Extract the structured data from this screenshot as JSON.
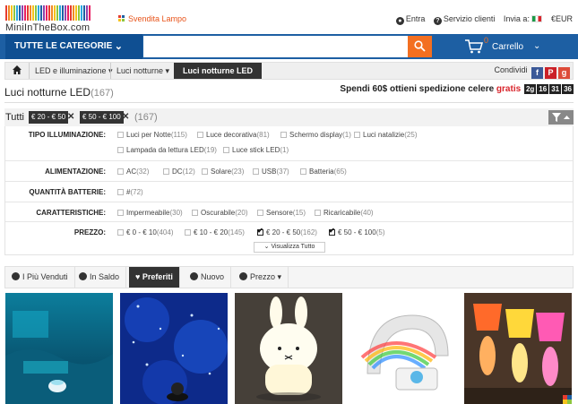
{
  "header": {
    "logo_text": "MiniInTheBox.com",
    "flash_sale": "Svendita Lampo",
    "links": {
      "login": "Entra",
      "support": "Servizio clienti",
      "ship_to": "Invia a:",
      "currency": "€EUR"
    }
  },
  "search": {
    "all_categories": "TUTTE LE CATEGORIE",
    "query": "",
    "placeholder": "",
    "cart_label": "Carrello",
    "cart_count": "0"
  },
  "breadcrumb": {
    "items": [
      "LED e illuminazione",
      "Luci notturne",
      "Luci notturne LED"
    ],
    "share_label": "Condividi"
  },
  "page": {
    "title": "Luci notturne LED",
    "count": "(167)",
    "promo_text": "Spendi 60$ ottieni spedizione celere",
    "promo_free": "gratis",
    "timer": [
      "2g",
      "16",
      "31",
      "36"
    ]
  },
  "active_filters": {
    "label": "Tutti",
    "chips": [
      "€ 20 - € 50",
      "€ 50 - € 100"
    ],
    "count": "(167)"
  },
  "filters": [
    {
      "label": "TIPO ILLUMINAZIONE:",
      "options": [
        {
          "name": "Luci per Notte",
          "count": "(115)",
          "checked": false
        },
        {
          "name": "Luce decorativa",
          "count": "(81)",
          "checked": false
        },
        {
          "name": "Schermo display",
          "count": "(1)",
          "checked": false
        },
        {
          "name": "Luci natalizie",
          "count": "(25)",
          "checked": false
        },
        {
          "name": "Lampada da lettura LED",
          "count": "(19)",
          "checked": false
        },
        {
          "name": "Luce stick LED",
          "count": "(1)",
          "checked": false
        }
      ]
    },
    {
      "label": "ALIMENTAZIONE:",
      "options": [
        {
          "name": "AC",
          "count": "(32)",
          "checked": false
        },
        {
          "name": "DC",
          "count": "(12)",
          "checked": false
        },
        {
          "name": "Solare",
          "count": "(23)",
          "checked": false
        },
        {
          "name": "USB",
          "count": "(37)",
          "checked": false
        },
        {
          "name": "Batteria",
          "count": "(65)",
          "checked": false
        }
      ]
    },
    {
      "label": "QUANTITÀ BATTERIE:",
      "options": [
        {
          "name": "#",
          "count": "(72)",
          "checked": false
        }
      ]
    },
    {
      "label": "CARATTERISTICHE:",
      "options": [
        {
          "name": "Impermeabile",
          "count": "(30)",
          "checked": false
        },
        {
          "name": "Oscurabile",
          "count": "(20)",
          "checked": false
        },
        {
          "name": "Sensore",
          "count": "(15)",
          "checked": false
        },
        {
          "name": "Ricaricabile",
          "count": "(40)",
          "checked": false
        }
      ]
    },
    {
      "label": "PREZZO:",
      "options": [
        {
          "name": "€ 0 - € 10",
          "count": "(404)",
          "checked": false
        },
        {
          "name": "€ 10 - € 20",
          "count": "(145)",
          "checked": false
        },
        {
          "name": "€ 20 - € 50",
          "count": "(162)",
          "checked": true
        },
        {
          "name": "€ 50 - € 100",
          "count": "(5)",
          "checked": true
        }
      ]
    }
  ],
  "show_all": "Visualizza Tutto",
  "sort_tabs": [
    {
      "label": "I Più Venduti",
      "icon": "thumbs-up-icon",
      "active": false
    },
    {
      "label": "In Saldo",
      "icon": "sale-icon",
      "active": false
    },
    {
      "label": "Preferiti",
      "icon": "heart-icon",
      "active": true
    },
    {
      "label": "Nuovo",
      "icon": "new-icon",
      "active": false
    },
    {
      "label": "Prezzo",
      "icon": "price-icon",
      "active": false
    }
  ],
  "products": [
    {
      "name": "ocean-projector-lamp"
    },
    {
      "name": "star-projector-lamp"
    },
    {
      "name": "bunny-night-light"
    },
    {
      "name": "rainbow-projector-lamp"
    },
    {
      "name": "colorful-lampshade-figures"
    }
  ],
  "colors": {
    "brand_blue": "#1d5fa3",
    "dark_blue": "#0f4f92",
    "orange": "#f36f21",
    "promo_red": "#d9252c"
  }
}
